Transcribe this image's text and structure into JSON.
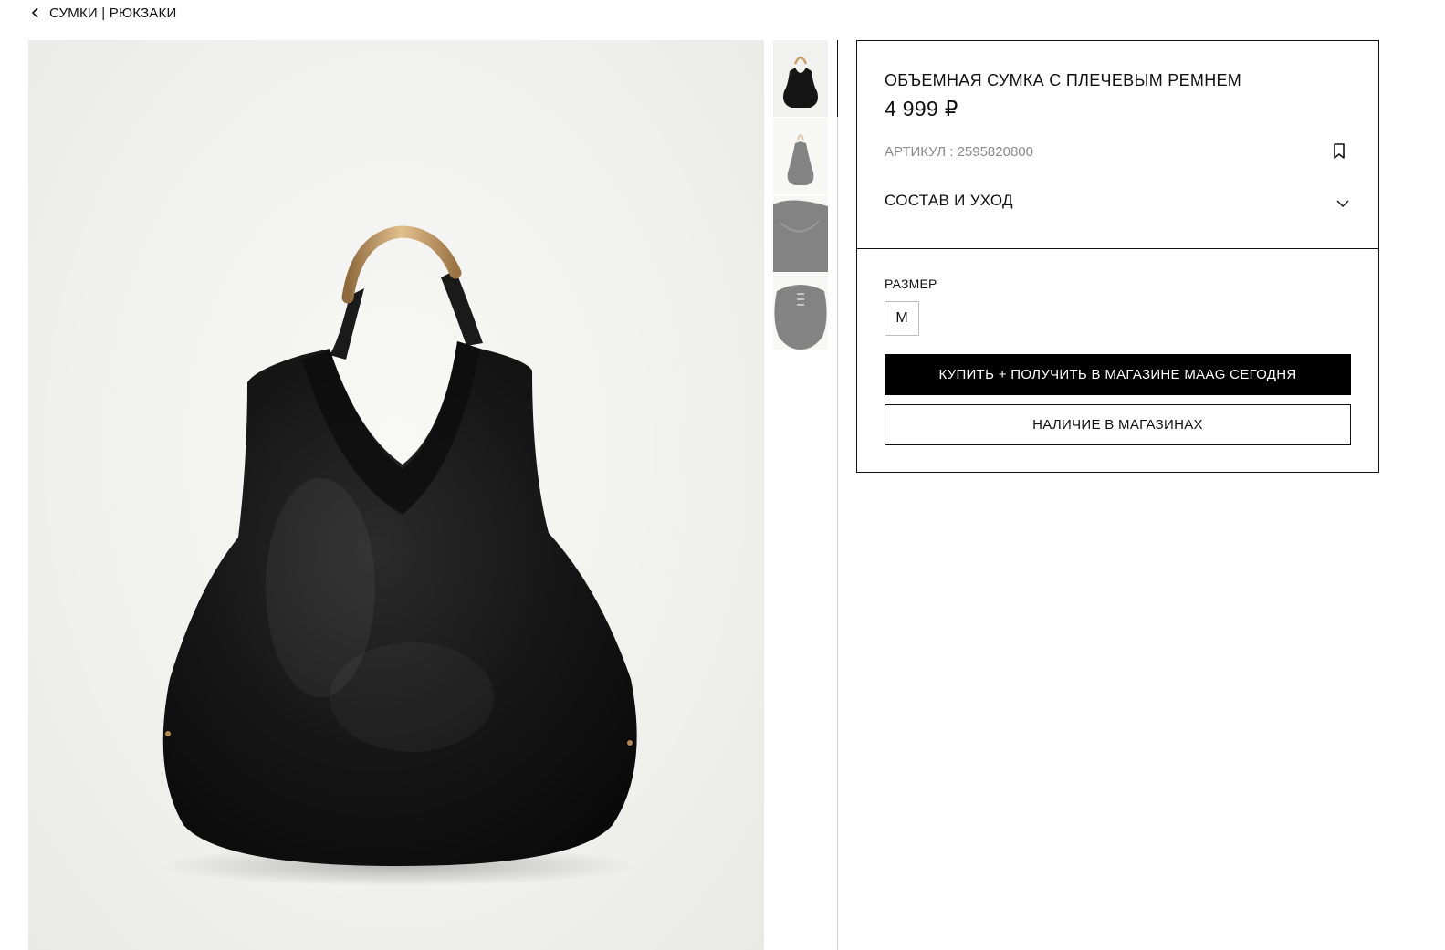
{
  "breadcrumb": {
    "icon": "chevron-left-icon",
    "label": "СУМКИ | РЮКЗАКИ"
  },
  "gallery": {
    "thumbnails": [
      {
        "name": "thumbnail-front",
        "active": true
      },
      {
        "name": "thumbnail-side",
        "active": false
      },
      {
        "name": "thumbnail-detail",
        "active": false
      },
      {
        "name": "thumbnail-back",
        "active": false
      }
    ],
    "product_color": "#141414",
    "handle_color": "#c9a06a"
  },
  "product": {
    "title": "ОБЪЕМНАЯ СУМКА С ПЛЕЧЕВЫМ РЕМНЕМ",
    "price": "4 999 ₽",
    "sku": "АРТИКУЛ : 2595820800",
    "bookmark_icon": "bookmark-icon",
    "composition_label": "СОСТАВ И УХОД",
    "composition_icon": "chevron-down-icon"
  },
  "size": {
    "label": "РАЗМЕР",
    "options": [
      "M"
    ]
  },
  "actions": {
    "buy_label": "КУПИТЬ + ПОЛУЧИТЬ В МАГАЗИНЕ MAAG СЕГОДНЯ",
    "stock_label": "НАЛИЧИЕ В МАГАЗИНАХ"
  },
  "colors": {
    "primary": "#000000",
    "border": "#111111",
    "muted_text": "#8a8a8a"
  }
}
